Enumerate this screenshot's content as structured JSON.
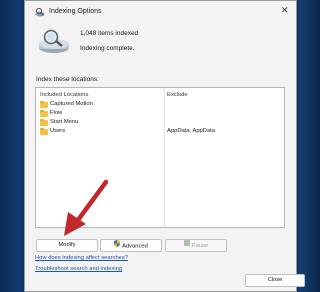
{
  "window": {
    "title": "Indexing Options",
    "close_glyph": "✕"
  },
  "summary": {
    "items_indexed": "1,048 items indexed",
    "status": "Indexing complete."
  },
  "locations": {
    "heading": "Index these locations:",
    "exclude_heading": "Exclude",
    "col_included": "Included Locations",
    "col_exclude": "Exclude",
    "rows": [
      {
        "location": "Captured Motion",
        "exclude": ""
      },
      {
        "location": "Flow",
        "exclude": ""
      },
      {
        "location": "Start Menu",
        "exclude": ""
      },
      {
        "location": "Users",
        "exclude": "AppData; AppData"
      }
    ]
  },
  "buttons": {
    "modify": "Modify",
    "advanced": "Advanced",
    "pause": "Pause",
    "close": "Close"
  },
  "links": {
    "how_indexing": "How does indexing affect searches?",
    "troubleshoot": "Troubleshoot search and indexing"
  },
  "colors": {
    "folder": "#f5c244",
    "link": "#1a56b8",
    "annotation_arrow": "#c0282d",
    "window_bg": "#f3f3f3"
  },
  "icons": [
    "indexing-options-icon",
    "magnifier-drive-icon",
    "folder-icon",
    "shield-icon",
    "pause-icon",
    "close-icon",
    "annotation-arrow-icon"
  ]
}
